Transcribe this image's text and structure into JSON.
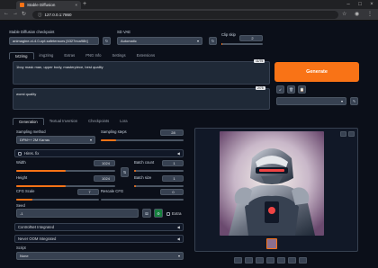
{
  "browser": {
    "tab_title": "Stable Diffusion",
    "url": "127.0.0.1:7860"
  },
  "top": {
    "checkpoint_label": "Stable Diffusion checkpoint",
    "checkpoint_value": "animagine-xl-4.0-opt.safetensors [6327eca98b]",
    "vae_label": "SD VAE",
    "vae_value": "Automatic",
    "clip_label": "Clip skip",
    "clip_value": "2"
  },
  "main_tabs": [
    "txt2img",
    "img2img",
    "Extras",
    "PNG Info",
    "Settings",
    "Extensions"
  ],
  "prompt": {
    "text": "1boy mask man, upper body, masterpiece, best quality",
    "count": "11/75"
  },
  "negative": {
    "text": "worst quality",
    "count": "2/75"
  },
  "generate_label": "Generate",
  "sub_tabs": [
    "Generation",
    "Textual Inversion",
    "Checkpoints",
    "Lora"
  ],
  "sampling": {
    "method_label": "Sampling method",
    "method_value": "DPM++ 2M Karras",
    "steps_label": "Sampling steps",
    "steps_value": "28",
    "steps_fraction": 0.19
  },
  "hires_label": "Hires. fix",
  "size": {
    "width_label": "Width",
    "width_value": "1024",
    "width_fraction": 0.5,
    "height_label": "Height",
    "height_value": "1024",
    "height_fraction": 0.5,
    "batch_count_label": "Batch count",
    "batch_count_value": "1",
    "batch_size_label": "Batch size",
    "batch_size_value": "1"
  },
  "cfg": {
    "label": "CFG Scale",
    "value": "7",
    "fraction": 0.2,
    "rescale_label": "Rescale CFG",
    "rescale_value": "0"
  },
  "seed": {
    "label": "Seed",
    "value": "-1",
    "extra_label": "Extra"
  },
  "accordions": [
    "ControlNet Integrated",
    "Never OOM Integrated"
  ],
  "script": {
    "label": "Script",
    "value": "None"
  },
  "colors": {
    "accent": "#f97316",
    "background": "#0b0f19"
  }
}
